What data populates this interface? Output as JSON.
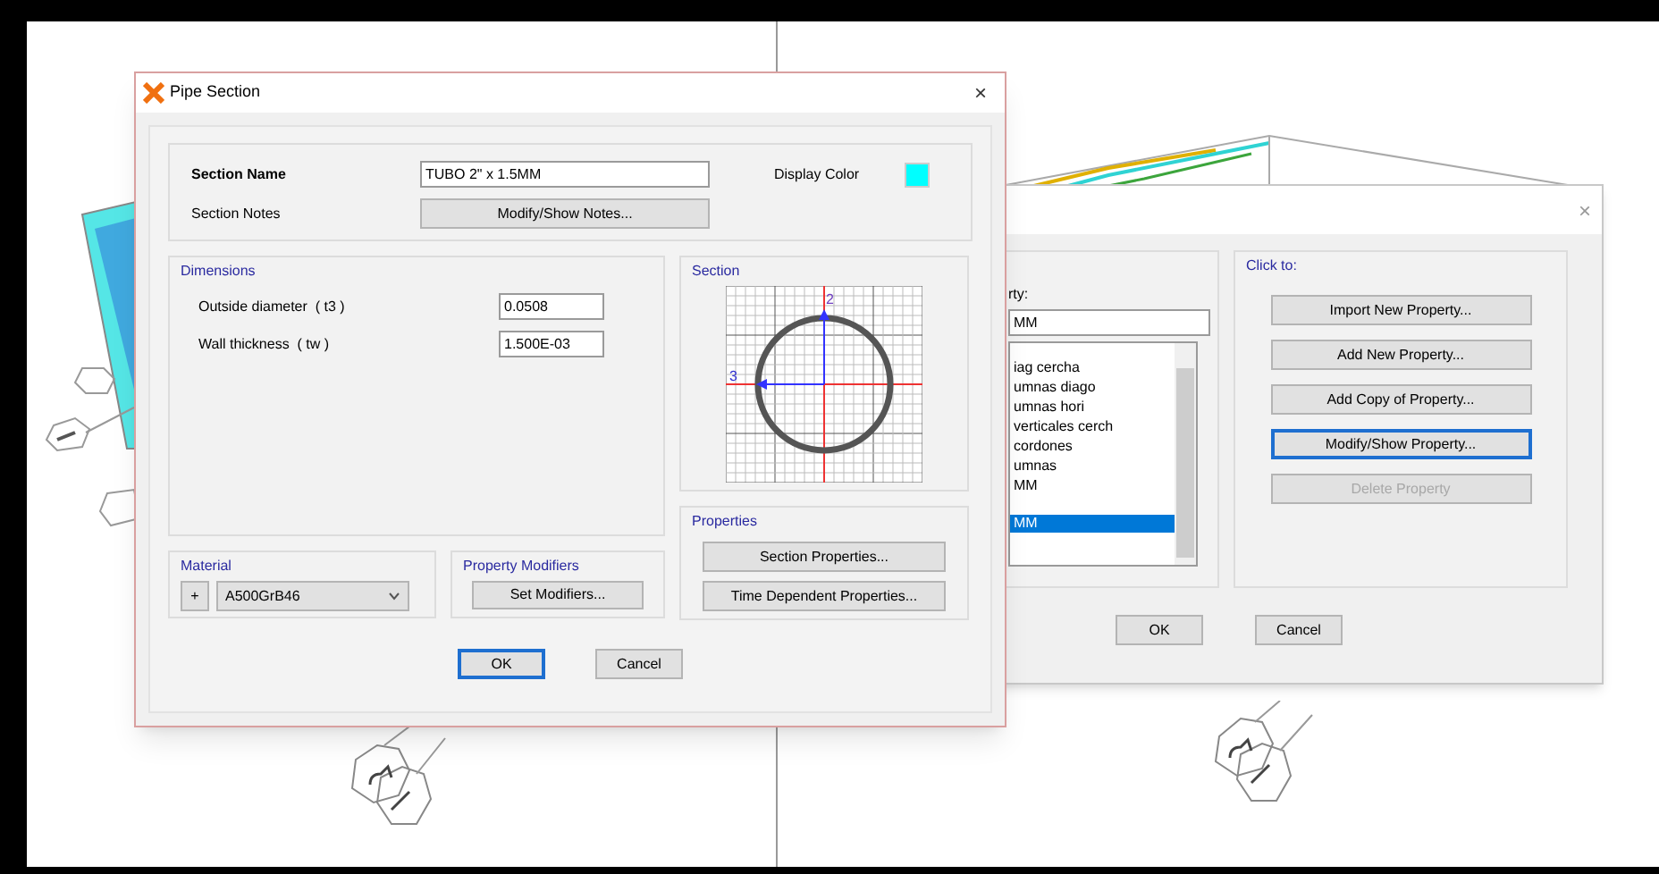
{
  "front_dialog": {
    "title": "Pipe Section",
    "close": "×",
    "section_name": {
      "label": "Section Name",
      "value": "TUBO 2\" x 1.5MM"
    },
    "section_notes": {
      "label": "Section Notes",
      "button": "Modify/Show Notes..."
    },
    "display_color": {
      "label": "Display Color",
      "color": "#00ffff"
    },
    "dimensions": {
      "title": "Dimensions",
      "fields": [
        {
          "label": "Outside diameter  ( t3 )",
          "value": "0.0508"
        },
        {
          "label": "Wall thickness  ( tw )",
          "value": "1.500E-03"
        }
      ]
    },
    "section": {
      "title": "Section",
      "axis_labels": [
        "2",
        "3"
      ]
    },
    "material": {
      "title": "Material",
      "add_button": "+",
      "value": "A500GrB46"
    },
    "property_modifiers": {
      "title": "Property Modifiers",
      "button": "Set Modifiers..."
    },
    "properties": {
      "title": "Properties",
      "buttons": [
        "Section Properties...",
        "Time Dependent Properties..."
      ]
    },
    "buttons": [
      {
        "label": "OK",
        "focused": true
      },
      {
        "label": "Cancel",
        "focused": false
      }
    ]
  },
  "back_dialog": {
    "close": "×",
    "property_label": "rty:",
    "property_value": "MM",
    "list": [
      {
        "label": "iag cercha",
        "selected": false
      },
      {
        "label": "umnas diago",
        "selected": false
      },
      {
        "label": "umnas hori",
        "selected": false
      },
      {
        "label": "verticales cerch",
        "selected": false
      },
      {
        "label": "cordones",
        "selected": false
      },
      {
        "label": "umnas",
        "selected": false
      },
      {
        "label": "MM",
        "selected": false
      },
      {
        "label": "MM",
        "selected": true
      }
    ],
    "click_to": {
      "title": "Click to:",
      "buttons": [
        {
          "label": "Import New Property...",
          "disabled": false,
          "focused": false
        },
        {
          "label": "Add New Property...",
          "disabled": false,
          "focused": false
        },
        {
          "label": "Add Copy of Property...",
          "disabled": false,
          "focused": false
        },
        {
          "label": "Modify/Show Property...",
          "disabled": false,
          "focused": true
        },
        {
          "label": "Delete Property",
          "disabled": true,
          "focused": false
        }
      ]
    },
    "buttons": [
      "OK",
      "Cancel"
    ]
  }
}
